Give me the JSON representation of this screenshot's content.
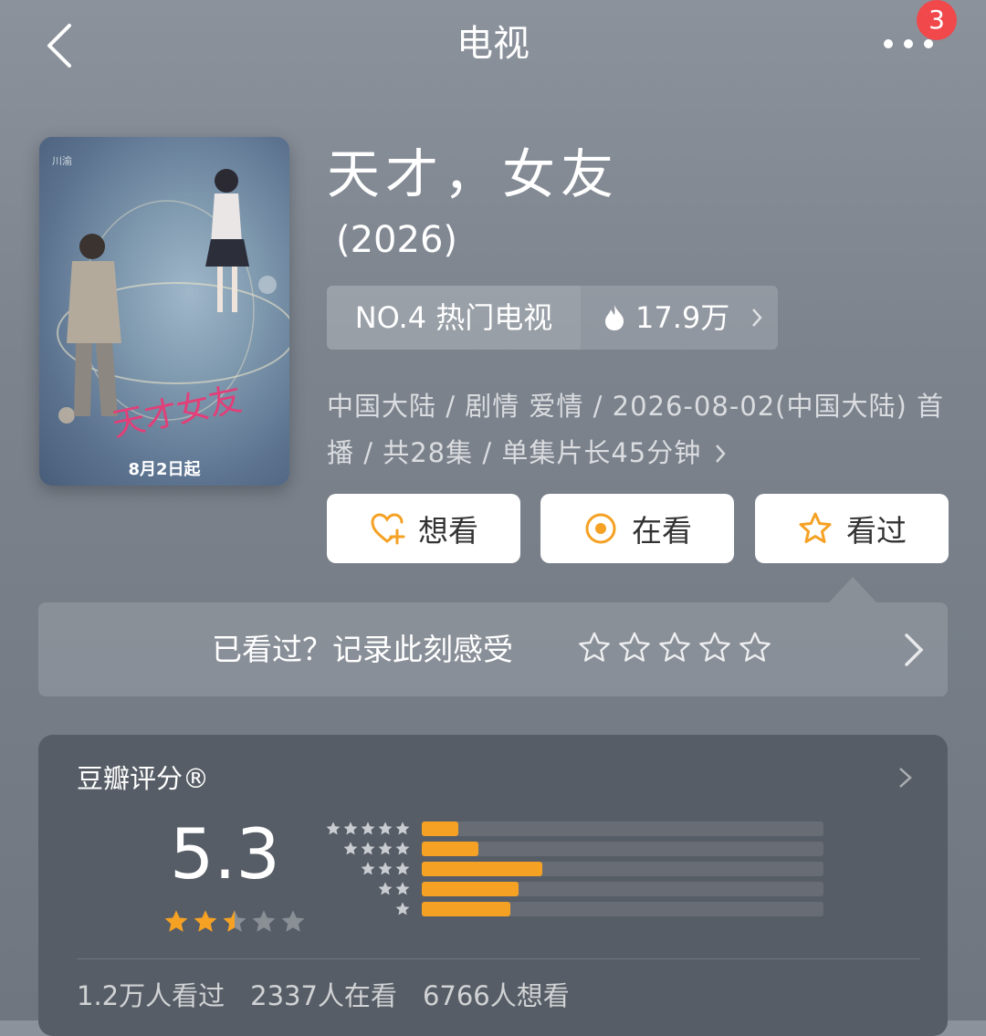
{
  "header": {
    "title": "电视",
    "notification_count": "3"
  },
  "poster": {
    "caption": "8月2日起"
  },
  "show": {
    "title": "天才，女友",
    "year": "(2026)",
    "rank_label": "NO.4 热门电视",
    "heat": "17.9万",
    "meta_line1": "中国大陆 / 剧情 爱情 / 2026-08-02(中国大陆) 首",
    "meta_line2": "播 / 共28集 / 单集片长45分钟"
  },
  "actions": {
    "want": "想看",
    "watching": "在看",
    "watched": "看过"
  },
  "feel": {
    "prompt": "已看过？记录此刻感受"
  },
  "rating": {
    "title": "豆瓣评分®",
    "score": "5.3",
    "star_fill": 2.5,
    "distribution": [
      {
        "stars": 5,
        "percent": 9
      },
      {
        "stars": 4,
        "percent": 14
      },
      {
        "stars": 3,
        "percent": 30
      },
      {
        "stars": 2,
        "percent": 24
      },
      {
        "stars": 1,
        "percent": 22
      }
    ],
    "stats": [
      "1.2万人看过",
      "2337人在看",
      "6766人想看"
    ]
  },
  "colors": {
    "accent": "#f5a124",
    "badge": "#f0484b",
    "card": "#575d66"
  }
}
